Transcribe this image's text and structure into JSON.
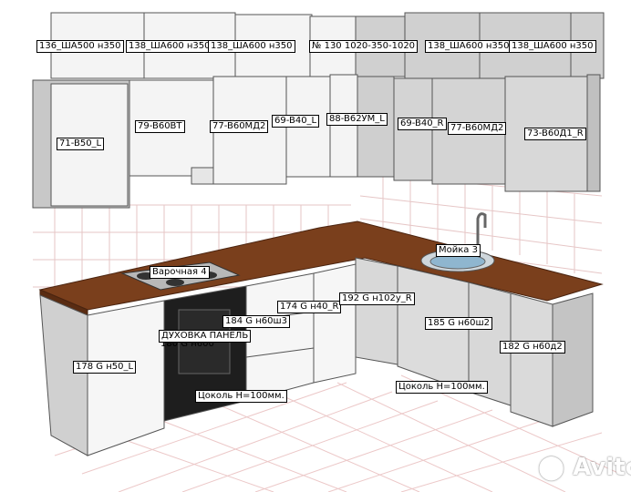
{
  "labels": {
    "upper_1": "136_ШA500 н350",
    "upper_2": "138_ШA600 н350",
    "upper_3": "138_ШA600 н350",
    "upper_4": "№ 130 1020-350-1020",
    "upper_5": "138_ШA600 н350",
    "upper_6": "138_ШA600 н350",
    "wall_1": "71-B50_L",
    "wall_2": "79-B60BT",
    "wall_3": "77-B60MД2",
    "wall_4": "69-B40_L",
    "wall_5": "88-B62УM_L",
    "wall_6": "69-B40_R",
    "wall_7": "77-B60MД2",
    "wall_8": "73-B60Д1_R",
    "hob": "Варочная 4",
    "sink": "Мойка 3",
    "base_1": "178 G н50_L",
    "base_2": "174 G н40_R",
    "base_3": "192 G н102у_R",
    "base_4": "184 G н60ш3",
    "base_5": "185 G н60ш2",
    "base_6": "182 G н60д2",
    "oven": "ДУХОВКА ПАНЕЛЬ",
    "oven_sub": "180 G н600",
    "plinth_1": "Цоколь H=100мм.",
    "plinth_2": "Цоколь H=100мм."
  },
  "watermark": "Avito",
  "colors": {
    "worktop": "#7a3f1c",
    "cabinet_front": "#f4f4f4",
    "cabinet_side": "#c9c9c9",
    "grid": "#e8c8c8"
  }
}
